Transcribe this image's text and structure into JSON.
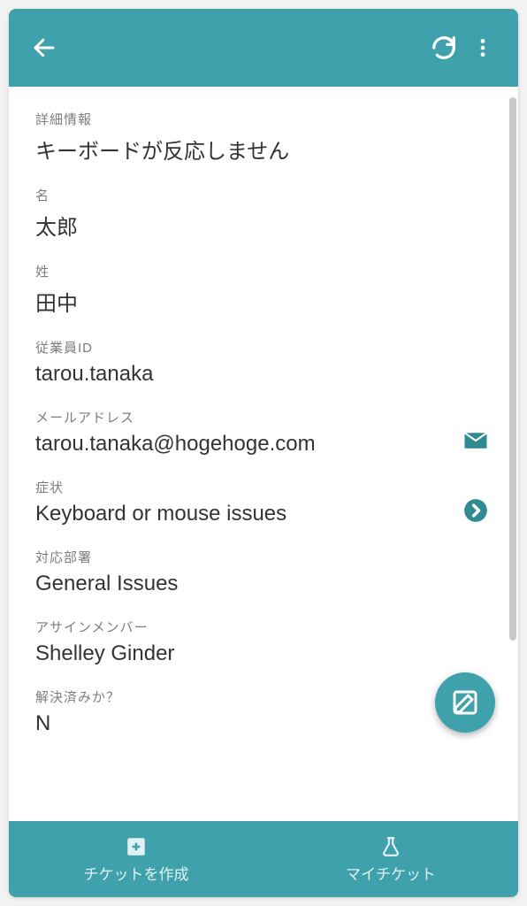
{
  "colors": {
    "accent": "#3ea1ab"
  },
  "fields": {
    "detail": {
      "label": "詳細情報",
      "value": "キーボードが反応しません"
    },
    "firstName": {
      "label": "名",
      "value": "太郎"
    },
    "lastName": {
      "label": "姓",
      "value": "田中"
    },
    "employeeId": {
      "label": "従業員ID",
      "value": "tarou.tanaka"
    },
    "email": {
      "label": "メールアドレス",
      "value": "tarou.tanaka@hogehoge.com"
    },
    "symptom": {
      "label": "症状",
      "value": "Keyboard or mouse issues"
    },
    "department": {
      "label": "対応部署",
      "value": "General Issues"
    },
    "assignee": {
      "label": "アサインメンバー",
      "value": "Shelley Ginder"
    },
    "resolved": {
      "label": "解決済みか？",
      "value": "N"
    }
  },
  "bottom": {
    "create": "チケットを作成",
    "my": "マイチケット"
  }
}
